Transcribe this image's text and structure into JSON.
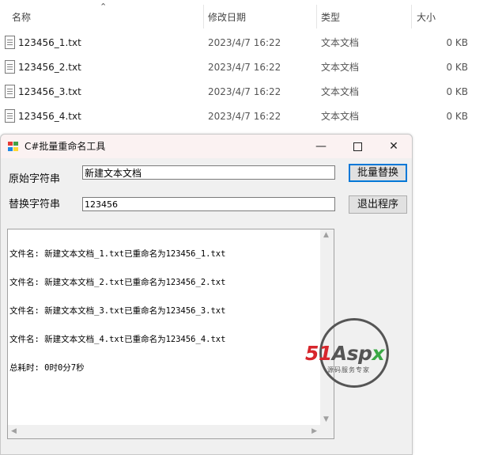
{
  "explorer": {
    "columns": [
      "名称",
      "修改日期",
      "类型",
      "大小"
    ],
    "files": [
      {
        "name": "123456_1.txt",
        "date": "2023/4/7 16:22",
        "type": "文本文档",
        "size": "0 KB"
      },
      {
        "name": "123456_2.txt",
        "date": "2023/4/7 16:22",
        "type": "文本文档",
        "size": "0 KB"
      },
      {
        "name": "123456_3.txt",
        "date": "2023/4/7 16:22",
        "type": "文本文档",
        "size": "0 KB"
      },
      {
        "name": "123456_4.txt",
        "date": "2023/4/7 16:22",
        "type": "文本文档",
        "size": "0 KB"
      }
    ]
  },
  "window": {
    "title": "C#批量重命名工具",
    "minimize": "—",
    "close": "✕",
    "original_label": "原始字符串",
    "original_value": "新建文本文档",
    "replace_label": "替换字符串",
    "replace_value": "123456",
    "batch_button": "批量替换",
    "exit_button": "退出程序",
    "log": [
      "文件名: 新建文本文档_1.txt已重命名为123456_1.txt",
      "文件名: 新建文本文档_2.txt已重命名为123456_2.txt",
      "文件名: 新建文本文档_3.txt已重命名为123456_3.txt",
      "文件名: 新建文本文档_4.txt已重命名为123456_4.txt",
      "总耗时: 0时0分7秒"
    ]
  },
  "watermark": {
    "brand": "51Aspx",
    "tagline": "源码服务专家"
  },
  "colors": {
    "titlebar": "#fbf2f2",
    "focus": "#0078d7",
    "brand_red": "#d7262c",
    "brand_green": "#3aa845"
  }
}
